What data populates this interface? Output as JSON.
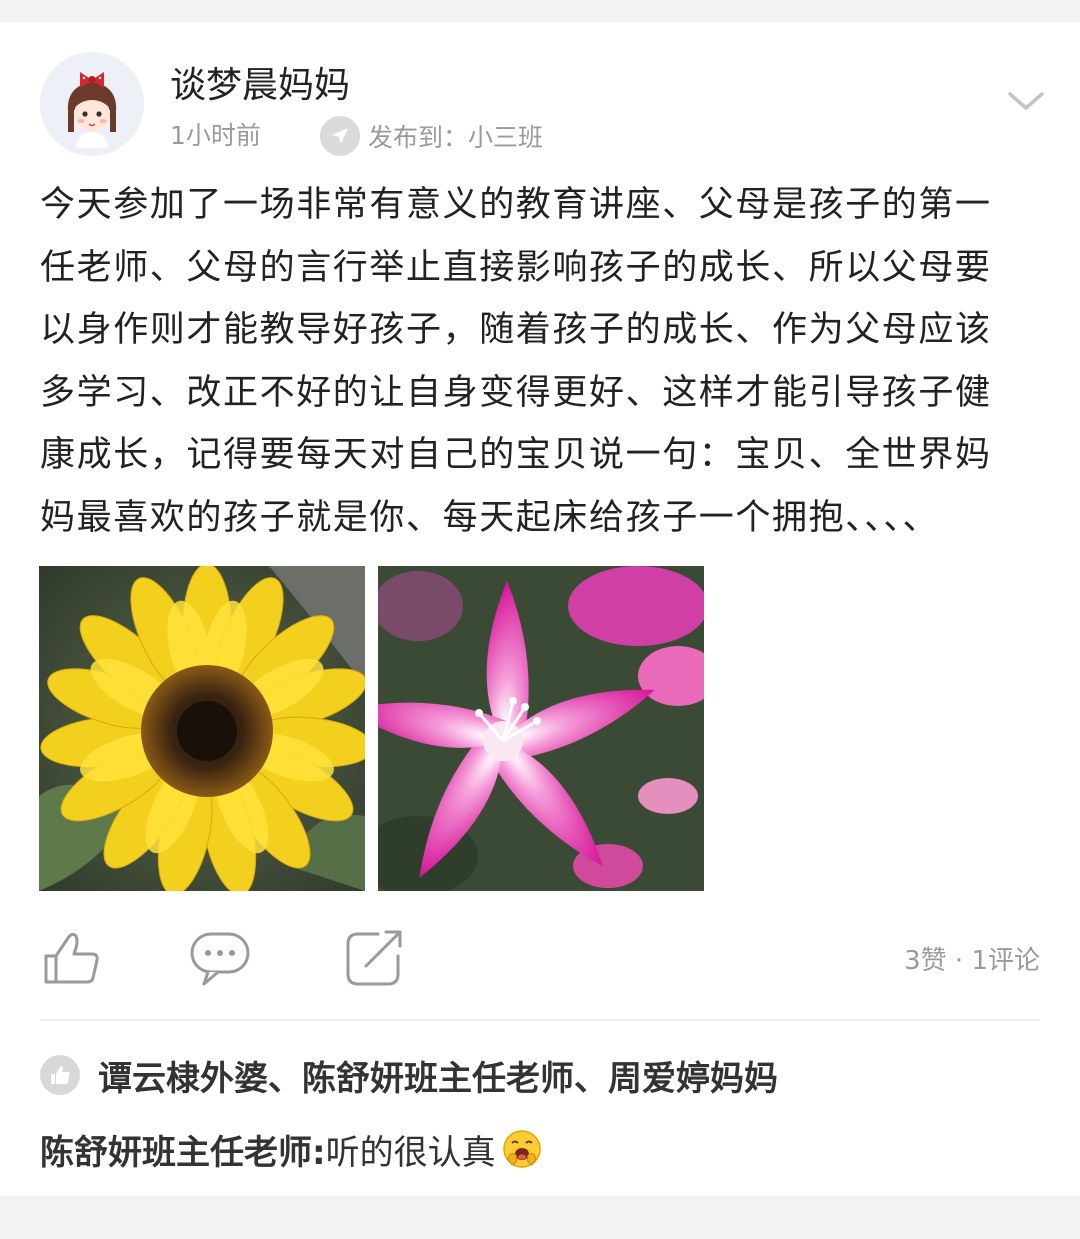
{
  "post": {
    "author": "谈梦晨妈妈",
    "time": "1小时前",
    "publish_to": "发布到：小三班",
    "body_lines": [
      "今天参加了一场非常有意义的教育讲座、父母是孩子的第一",
      "任老师、父母的言行举止直接影响孩子的成长、所以父母要",
      "以身作则才能教导好孩子，随着孩子的成长、作为父母应该",
      "多学习、改正不好的让自身变得更好、这样才能引导孩子健",
      "康成长，记得要每天对自己的宝贝说一句：宝贝、全世界妈",
      "妈最喜欢的孩子就是你、每天起床给孩子一个拥抱、、、、"
    ],
    "photos": [
      "sunflower-photo",
      "pink-flower-photo"
    ],
    "stats": "3赞 · 1评论"
  },
  "likes": {
    "names": "谭云棣外婆、陈舒妍班主任老师、周爱婷妈妈"
  },
  "comment": {
    "name": "陈舒妍班主任老师:",
    "text": "听的很认真",
    "emoji": "face-with-hand-over-mouth"
  },
  "icons": {
    "like": "thumbs-up-icon",
    "comment": "speech-bubble-icon",
    "share": "share-icon",
    "expand": "chevron-down-icon",
    "publish": "pin-icon"
  },
  "colors": {
    "text": "#222222",
    "muted": "#9a9a9a",
    "background": "#f2f2f4"
  }
}
